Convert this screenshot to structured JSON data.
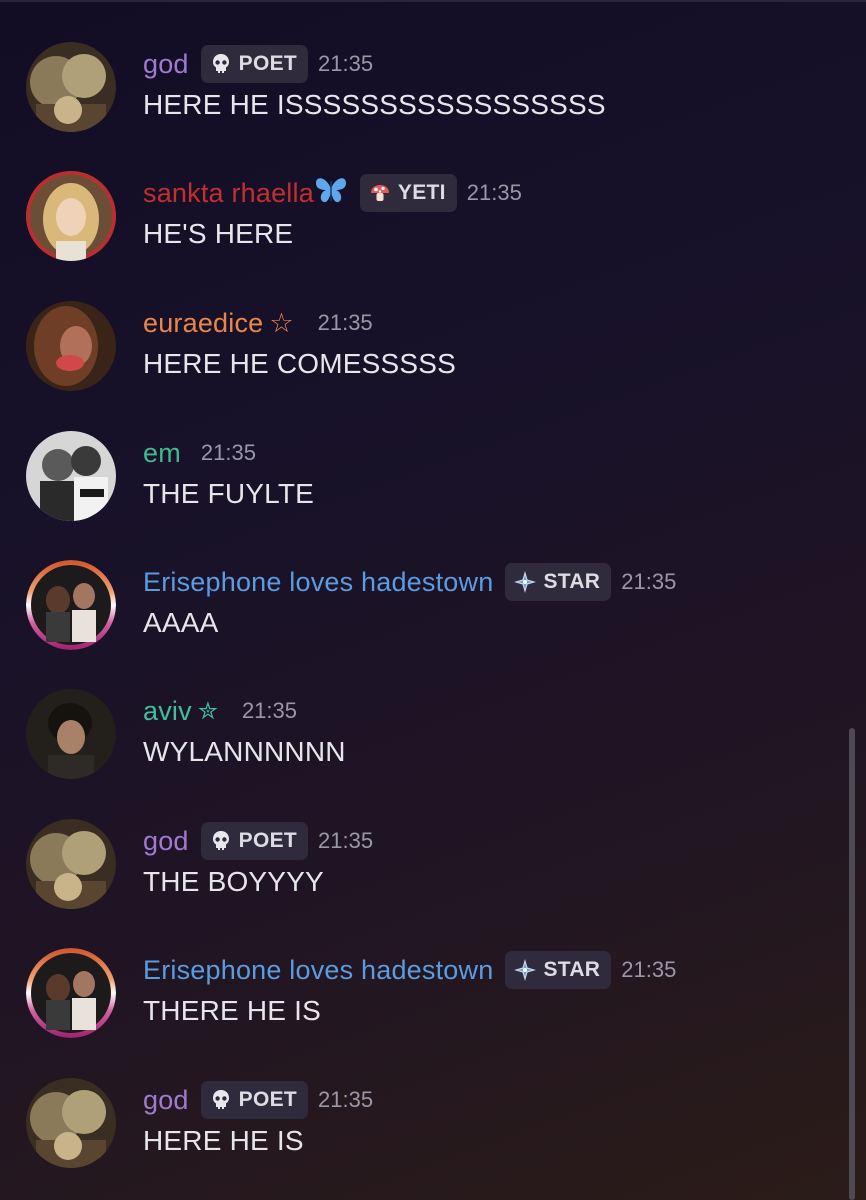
{
  "messages": [
    {
      "author": "god",
      "name_color": "#a07ad0",
      "badge": {
        "label": "POET",
        "icon": "skull-icon"
      },
      "time": "21:35",
      "text": "HERE HE ISSSSSSSSSSSSSSSSS"
    },
    {
      "author": "sankta rhaella",
      "name_color": "#c22f2f",
      "decoration": "🦋",
      "badge": {
        "label": "YETI",
        "icon": "mushroom-icon"
      },
      "time": "21:35",
      "text": "HE'S HERE"
    },
    {
      "author": "euraedice",
      "name_color": "#e8874a",
      "decoration": "☆",
      "time": "21:35",
      "text": "HERE HE COMESSSSS"
    },
    {
      "author": "em",
      "name_color": "#3fb990",
      "time": "21:35",
      "text": "THE FUYLTE"
    },
    {
      "author": "Erisephone loves hadestown",
      "name_color": "#5b9be0",
      "badge": {
        "label": "STAR",
        "icon": "sparkle-icon"
      },
      "time": "21:35",
      "text": "AAAA"
    },
    {
      "author": "aviv",
      "name_color": "#3fbf9d",
      "decoration": "✮",
      "time": "21:35",
      "text": "WYLANNNNNN"
    },
    {
      "author": "god",
      "name_color": "#a07ad0",
      "badge": {
        "label": "POET",
        "icon": "skull-icon"
      },
      "time": "21:35",
      "text": "THE BOYYYY"
    },
    {
      "author": "Erisephone loves hadestown",
      "name_color": "#5b9be0",
      "badge": {
        "label": "STAR",
        "icon": "sparkle-icon"
      },
      "time": "21:35",
      "text": "THERE HE IS"
    },
    {
      "author": "god",
      "name_color": "#a07ad0",
      "badge": {
        "label": "POET",
        "icon": "skull-icon"
      },
      "time": "21:35",
      "text": "HERE HE IS"
    }
  ]
}
